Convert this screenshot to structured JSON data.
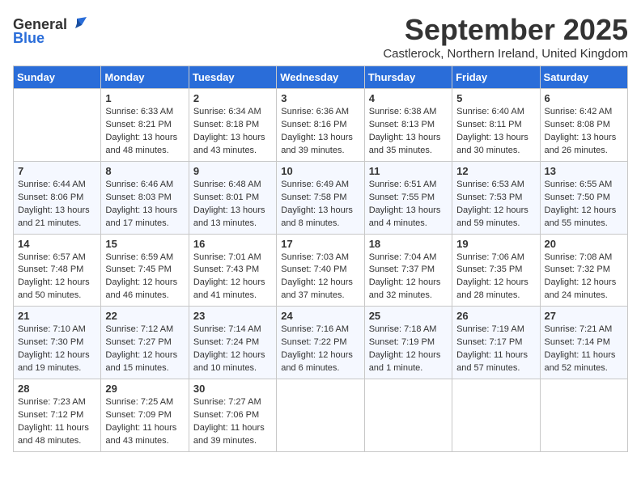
{
  "header": {
    "logo_general": "General",
    "logo_blue": "Blue",
    "month_title": "September 2025",
    "location": "Castlerock, Northern Ireland, United Kingdom"
  },
  "calendar": {
    "days_of_week": [
      "Sunday",
      "Monday",
      "Tuesday",
      "Wednesday",
      "Thursday",
      "Friday",
      "Saturday"
    ],
    "weeks": [
      [
        {
          "day": "",
          "info": ""
        },
        {
          "day": "1",
          "info": "Sunrise: 6:33 AM\nSunset: 8:21 PM\nDaylight: 13 hours\nand 48 minutes."
        },
        {
          "day": "2",
          "info": "Sunrise: 6:34 AM\nSunset: 8:18 PM\nDaylight: 13 hours\nand 43 minutes."
        },
        {
          "day": "3",
          "info": "Sunrise: 6:36 AM\nSunset: 8:16 PM\nDaylight: 13 hours\nand 39 minutes."
        },
        {
          "day": "4",
          "info": "Sunrise: 6:38 AM\nSunset: 8:13 PM\nDaylight: 13 hours\nand 35 minutes."
        },
        {
          "day": "5",
          "info": "Sunrise: 6:40 AM\nSunset: 8:11 PM\nDaylight: 13 hours\nand 30 minutes."
        },
        {
          "day": "6",
          "info": "Sunrise: 6:42 AM\nSunset: 8:08 PM\nDaylight: 13 hours\nand 26 minutes."
        }
      ],
      [
        {
          "day": "7",
          "info": "Sunrise: 6:44 AM\nSunset: 8:06 PM\nDaylight: 13 hours\nand 21 minutes."
        },
        {
          "day": "8",
          "info": "Sunrise: 6:46 AM\nSunset: 8:03 PM\nDaylight: 13 hours\nand 17 minutes."
        },
        {
          "day": "9",
          "info": "Sunrise: 6:48 AM\nSunset: 8:01 PM\nDaylight: 13 hours\nand 13 minutes."
        },
        {
          "day": "10",
          "info": "Sunrise: 6:49 AM\nSunset: 7:58 PM\nDaylight: 13 hours\nand 8 minutes."
        },
        {
          "day": "11",
          "info": "Sunrise: 6:51 AM\nSunset: 7:55 PM\nDaylight: 13 hours\nand 4 minutes."
        },
        {
          "day": "12",
          "info": "Sunrise: 6:53 AM\nSunset: 7:53 PM\nDaylight: 12 hours\nand 59 minutes."
        },
        {
          "day": "13",
          "info": "Sunrise: 6:55 AM\nSunset: 7:50 PM\nDaylight: 12 hours\nand 55 minutes."
        }
      ],
      [
        {
          "day": "14",
          "info": "Sunrise: 6:57 AM\nSunset: 7:48 PM\nDaylight: 12 hours\nand 50 minutes."
        },
        {
          "day": "15",
          "info": "Sunrise: 6:59 AM\nSunset: 7:45 PM\nDaylight: 12 hours\nand 46 minutes."
        },
        {
          "day": "16",
          "info": "Sunrise: 7:01 AM\nSunset: 7:43 PM\nDaylight: 12 hours\nand 41 minutes."
        },
        {
          "day": "17",
          "info": "Sunrise: 7:03 AM\nSunset: 7:40 PM\nDaylight: 12 hours\nand 37 minutes."
        },
        {
          "day": "18",
          "info": "Sunrise: 7:04 AM\nSunset: 7:37 PM\nDaylight: 12 hours\nand 32 minutes."
        },
        {
          "day": "19",
          "info": "Sunrise: 7:06 AM\nSunset: 7:35 PM\nDaylight: 12 hours\nand 28 minutes."
        },
        {
          "day": "20",
          "info": "Sunrise: 7:08 AM\nSunset: 7:32 PM\nDaylight: 12 hours\nand 24 minutes."
        }
      ],
      [
        {
          "day": "21",
          "info": "Sunrise: 7:10 AM\nSunset: 7:30 PM\nDaylight: 12 hours\nand 19 minutes."
        },
        {
          "day": "22",
          "info": "Sunrise: 7:12 AM\nSunset: 7:27 PM\nDaylight: 12 hours\nand 15 minutes."
        },
        {
          "day": "23",
          "info": "Sunrise: 7:14 AM\nSunset: 7:24 PM\nDaylight: 12 hours\nand 10 minutes."
        },
        {
          "day": "24",
          "info": "Sunrise: 7:16 AM\nSunset: 7:22 PM\nDaylight: 12 hours\nand 6 minutes."
        },
        {
          "day": "25",
          "info": "Sunrise: 7:18 AM\nSunset: 7:19 PM\nDaylight: 12 hours\nand 1 minute."
        },
        {
          "day": "26",
          "info": "Sunrise: 7:19 AM\nSunset: 7:17 PM\nDaylight: 11 hours\nand 57 minutes."
        },
        {
          "day": "27",
          "info": "Sunrise: 7:21 AM\nSunset: 7:14 PM\nDaylight: 11 hours\nand 52 minutes."
        }
      ],
      [
        {
          "day": "28",
          "info": "Sunrise: 7:23 AM\nSunset: 7:12 PM\nDaylight: 11 hours\nand 48 minutes."
        },
        {
          "day": "29",
          "info": "Sunrise: 7:25 AM\nSunset: 7:09 PM\nDaylight: 11 hours\nand 43 minutes."
        },
        {
          "day": "30",
          "info": "Sunrise: 7:27 AM\nSunset: 7:06 PM\nDaylight: 11 hours\nand 39 minutes."
        },
        {
          "day": "",
          "info": ""
        },
        {
          "day": "",
          "info": ""
        },
        {
          "day": "",
          "info": ""
        },
        {
          "day": "",
          "info": ""
        }
      ]
    ]
  }
}
